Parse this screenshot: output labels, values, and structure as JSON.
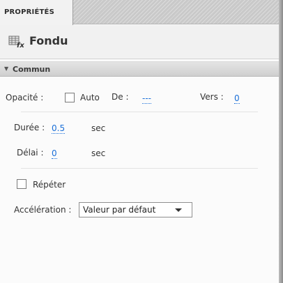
{
  "tab": {
    "label": "PROPRIÉTÉS"
  },
  "header": {
    "title": "Fondu",
    "icon": "fade-effect-icon"
  },
  "section": {
    "label": "Commun",
    "state": "expanded"
  },
  "opacity": {
    "label": "Opacité :",
    "auto_label": "Auto",
    "auto_checked": false,
    "from_label": "De :",
    "from_value": "---",
    "to_label": "Vers :",
    "to_value": "0"
  },
  "duration": {
    "label": "Durée :",
    "value": "0.5",
    "unit": "sec"
  },
  "delay": {
    "label": "Délai :",
    "value": "0",
    "unit": "sec"
  },
  "repeat": {
    "label": "Répéter",
    "checked": false
  },
  "easing": {
    "label": "Accélération :",
    "selected": "Valeur par défaut"
  },
  "colors": {
    "link": "#1a6fd8",
    "text": "#333333",
    "panel_bg": "#fbfbfb"
  }
}
